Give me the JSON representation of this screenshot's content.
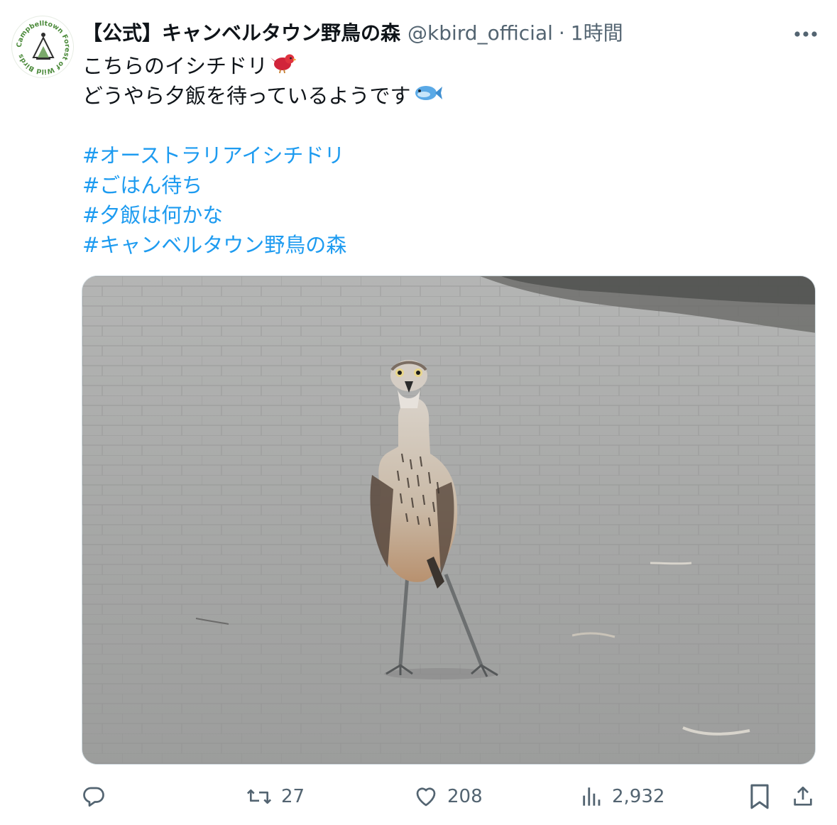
{
  "author": {
    "display_name": "【公式】キャンベルタウン野鳥の森",
    "handle": "@kbird_official",
    "separator": "·",
    "time": "1時間",
    "avatar_text": "Campbelltown Forest of Wild Birds",
    "avatar_color": "#4b8a3a"
  },
  "tweet": {
    "line1": "こちらのイシチドリ",
    "line1_emoji": "bird-emoji",
    "line2": "どうやら夕飯を待っているようです",
    "line2_emoji": "fish-emoji",
    "hashtags": [
      "#オーストラリアイシチドリ",
      "#ごはん待ち",
      "#夕飯は何かな",
      "#キャンベルタウン野鳥の森"
    ],
    "hashtag_color": "#1d9bf0"
  },
  "media": {
    "type": "photo",
    "subject": "bush stone-curlew standing on paved path"
  },
  "actions": {
    "reply": {
      "icon": "reply-icon",
      "count": ""
    },
    "retweet": {
      "icon": "retweet-icon",
      "count": "27"
    },
    "like": {
      "icon": "heart-icon",
      "count": "208"
    },
    "views": {
      "icon": "views-icon",
      "count": "2,932"
    },
    "bookmark": {
      "icon": "bookmark-icon"
    },
    "share": {
      "icon": "share-icon"
    }
  },
  "colors": {
    "text": "#0f1419",
    "secondary": "#536471",
    "link": "#1d9bf0"
  }
}
